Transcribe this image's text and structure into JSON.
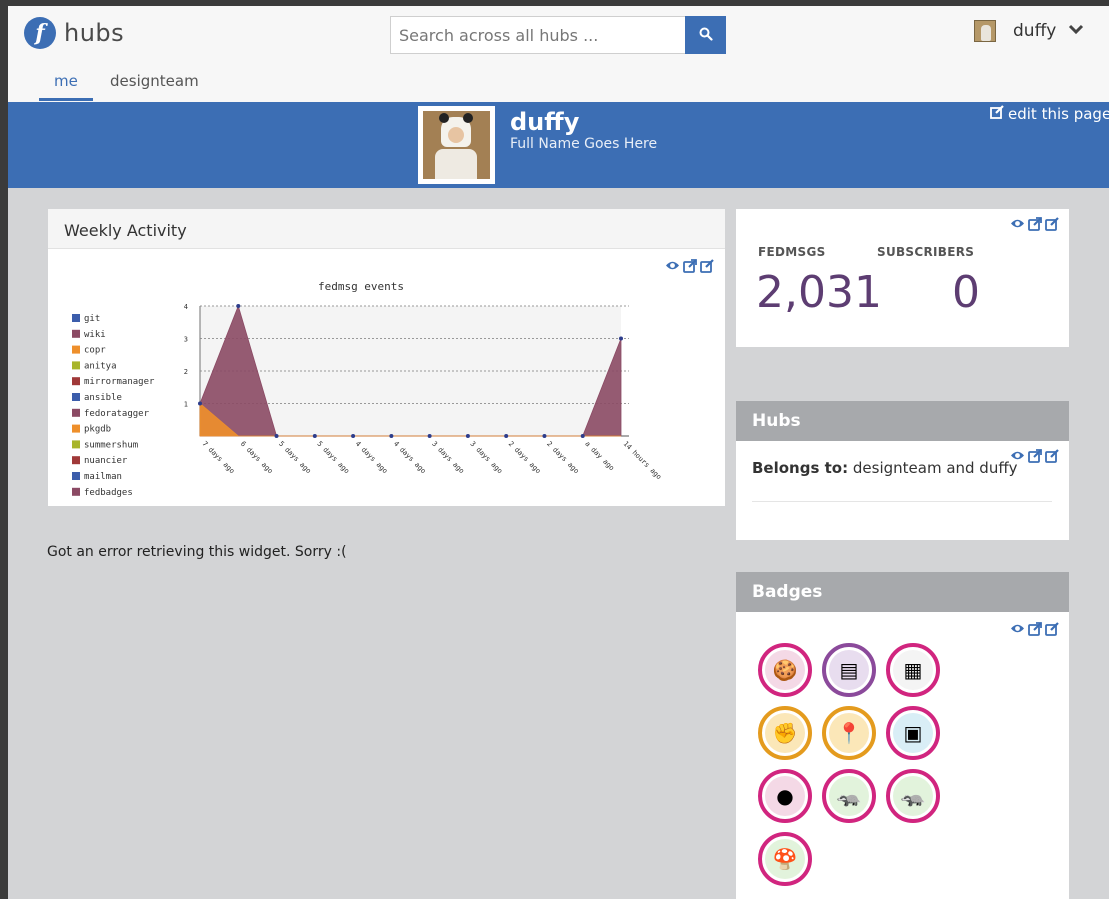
{
  "app": {
    "logo_letter": "f",
    "name": "hubs"
  },
  "search": {
    "placeholder": "Search across all hubs ..."
  },
  "user": {
    "name": "duffy"
  },
  "tabs": [
    {
      "label": "me"
    },
    {
      "label": "designteam"
    }
  ],
  "profile": {
    "username": "duffy",
    "full_name": "Full Name Goes Here",
    "edit_label": "edit this page"
  },
  "weekly": {
    "title": "Weekly Activity"
  },
  "stats": {
    "fedmsgs_label": "FEDMSGS",
    "fedmsgs_value": "2,031",
    "subscribers_label": "SUBSCRIBERS",
    "subscribers_value": "0"
  },
  "hubs_card": {
    "title": "Hubs",
    "belongs_label": "Belongs to:",
    "belongs_value": "designteam and duffy"
  },
  "badges_card": {
    "title": "Badges"
  },
  "error_text": "Got an error retrieving this widget. Sorry :(",
  "colors": {
    "accent": "#3c6eb4",
    "stat": "#5d3d72",
    "badge_ring": "#d1257f"
  },
  "icons": [
    "search-icon",
    "chevron-down-icon",
    "edit-icon",
    "eye-icon",
    "external-link-icon"
  ],
  "chart_data": {
    "type": "area",
    "title": "fedmsg events",
    "categories": [
      "7 days ago",
      "6 days ago",
      "5 days ago",
      "5 days ago",
      "4 days ago",
      "4 days ago",
      "3 days ago",
      "3 days ago",
      "2 days ago",
      "2 days ago",
      "a day ago",
      "14 hours ago"
    ],
    "ylim": [
      0,
      4
    ],
    "yticks": [
      1,
      2,
      3,
      4
    ],
    "legend_position": "left",
    "series": [
      {
        "name": "git",
        "color": "#3c5dab",
        "values": [
          0,
          0,
          0,
          0,
          0,
          0,
          0,
          0,
          0,
          0,
          0,
          0
        ]
      },
      {
        "name": "wiki",
        "color": "#8b4a64",
        "values": [
          1,
          4,
          0,
          0,
          0,
          0,
          0,
          0,
          0,
          0,
          0,
          3
        ]
      },
      {
        "name": "copr",
        "color": "#ee8f2b",
        "values": [
          1,
          0,
          0,
          0,
          0,
          0,
          0,
          0,
          0,
          0,
          0,
          0
        ]
      },
      {
        "name": "anitya",
        "color": "#a8b52a",
        "values": [
          0,
          0,
          0,
          0,
          0,
          0,
          0,
          0,
          0,
          0,
          0,
          0
        ]
      },
      {
        "name": "mirrormanager",
        "color": "#a03838",
        "values": [
          0,
          0,
          0,
          0,
          0,
          0,
          0,
          0,
          0,
          0,
          0,
          0
        ]
      },
      {
        "name": "ansible",
        "color": "#3c5dab",
        "values": [
          0,
          0,
          0,
          0,
          0,
          0,
          0,
          0,
          0,
          0,
          0,
          0
        ]
      },
      {
        "name": "fedoratagger",
        "color": "#8b4a64",
        "values": [
          0,
          0,
          0,
          0,
          0,
          0,
          0,
          0,
          0,
          0,
          0,
          0
        ]
      },
      {
        "name": "pkgdb",
        "color": "#ee8f2b",
        "values": [
          0,
          0,
          0,
          0,
          0,
          0,
          0,
          0,
          0,
          0,
          0,
          0
        ]
      },
      {
        "name": "summershum",
        "color": "#a8b52a",
        "values": [
          0,
          0,
          0,
          0,
          0,
          0,
          0,
          0,
          0,
          0,
          0,
          0
        ]
      },
      {
        "name": "nuancier",
        "color": "#a03838",
        "values": [
          0,
          0,
          0,
          0,
          0,
          0,
          0,
          0,
          0,
          0,
          0,
          0
        ]
      },
      {
        "name": "mailman",
        "color": "#3c5dab",
        "values": [
          0,
          0,
          0,
          0,
          0,
          0,
          0,
          0,
          0,
          0,
          0,
          0
        ]
      },
      {
        "name": "fedbadges",
        "color": "#8b4a64",
        "values": [
          0,
          0,
          0,
          0,
          0,
          0,
          0,
          0,
          0,
          0,
          0,
          0
        ]
      }
    ]
  },
  "badges": [
    {
      "icon": "cookie-badge-icon",
      "ring": "#d1257f",
      "glyph": "🍪",
      "bg": "#f4d9e6"
    },
    {
      "icon": "summit-badge-icon",
      "ring": "#8b4a9b",
      "glyph": "▤",
      "bg": "#e8ddef"
    },
    {
      "icon": "calendar-badger-badge-icon",
      "ring": "#d1257f",
      "glyph": "▦",
      "bg": "#f4f4f4"
    },
    {
      "icon": "boxing-gloves-badge-icon",
      "ring": "#e49b1e",
      "glyph": "✊",
      "bg": "#fbe7b8"
    },
    {
      "icon": "location-pin-badge-icon",
      "ring": "#e49b1e",
      "glyph": "📍",
      "bg": "#fbe7b8"
    },
    {
      "icon": "sign-badge-icon",
      "ring": "#d1257f",
      "glyph": "▣",
      "bg": "#d9eef6"
    },
    {
      "icon": "macaron-badge-icon",
      "ring": "#d1257f",
      "glyph": "●",
      "bg": "#f4d9e6"
    },
    {
      "icon": "badger-speech-badge-icon",
      "ring": "#d1257f",
      "glyph": "🦡",
      "bg": "#e2f3dc"
    },
    {
      "icon": "badger-dollar-badge-icon",
      "ring": "#d1257f",
      "glyph": "🦡",
      "bg": "#e2f3dc"
    },
    {
      "icon": "mushroom-badge-icon",
      "ring": "#d1257f",
      "glyph": "🍄",
      "bg": "#e2f3dc"
    }
  ]
}
